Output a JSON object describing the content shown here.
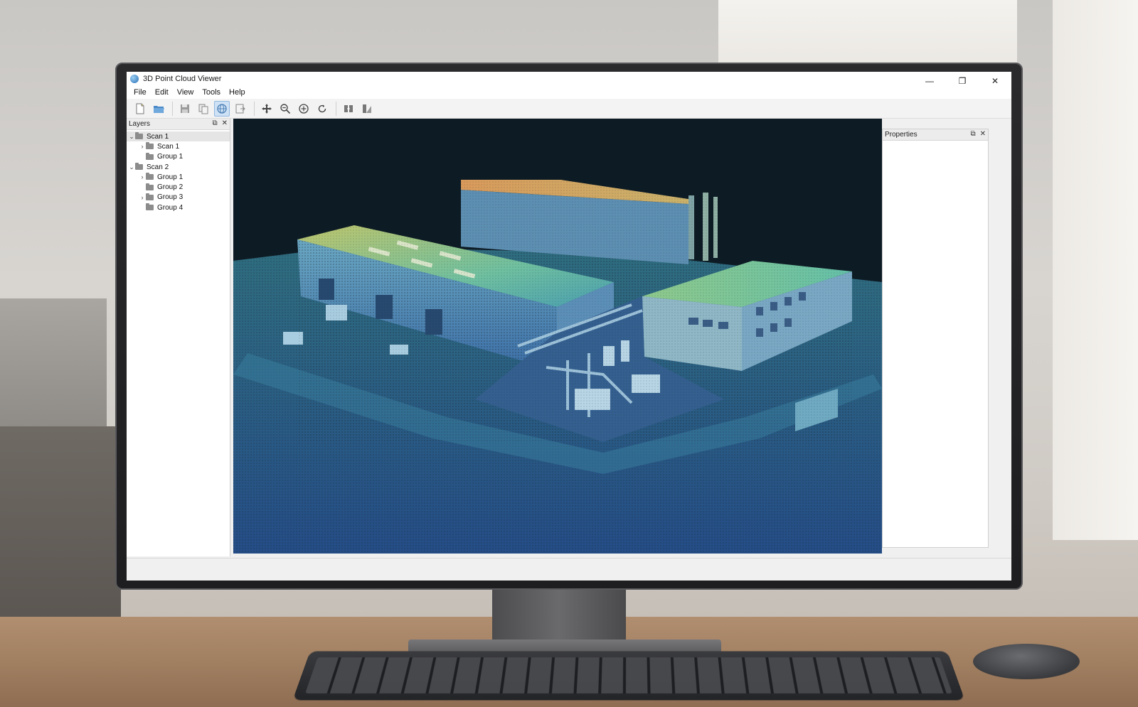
{
  "window": {
    "title": "3D Point Cloud Viewer",
    "minimize_glyph": "—",
    "restore_glyph": "❐",
    "close_glyph": "✕"
  },
  "menu": [
    {
      "label": "File"
    },
    {
      "label": "Edit"
    },
    {
      "label": "View"
    },
    {
      "label": "Tools"
    },
    {
      "label": "Help"
    }
  ],
  "toolbar": {
    "buttons": [
      {
        "icon": "new-file-icon"
      },
      {
        "icon": "open-folder-icon"
      },
      {
        "icon": "save-icon"
      },
      {
        "icon": "copy-icon"
      },
      {
        "icon": "globe-view-icon",
        "active": true
      },
      {
        "icon": "export-icon"
      },
      {
        "icon": "pan-move-icon"
      },
      {
        "icon": "zoom-out-icon"
      },
      {
        "icon": "zoom-in-icon"
      },
      {
        "icon": "rotate-icon"
      },
      {
        "icon": "fit-view-icon"
      },
      {
        "icon": "measure-icon"
      }
    ]
  },
  "layers_panel": {
    "title": "Layers",
    "tree": [
      {
        "label": "Scan 1",
        "level": 0,
        "expanded": true,
        "selected": true
      },
      {
        "label": "Scan 1",
        "level": 1,
        "expanded": false
      },
      {
        "label": "Group 1",
        "level": 1
      },
      {
        "label": "Scan 2",
        "level": 0,
        "expanded": true
      },
      {
        "label": "Group 1",
        "level": 1,
        "expanded": false
      },
      {
        "label": "Group 2",
        "level": 1
      },
      {
        "label": "Group 3",
        "level": 1,
        "expanded": false
      },
      {
        "label": "Group 4",
        "level": 1
      }
    ]
  },
  "properties_panel": {
    "title": "Properties"
  },
  "colors": {
    "viewport_bg": "#0d1b24",
    "pointcloud_low": "#3a6fb0",
    "pointcloud_mid": "#49b7a8",
    "pointcloud_high": "#d9a05a",
    "accent": "#2a6fb5"
  }
}
